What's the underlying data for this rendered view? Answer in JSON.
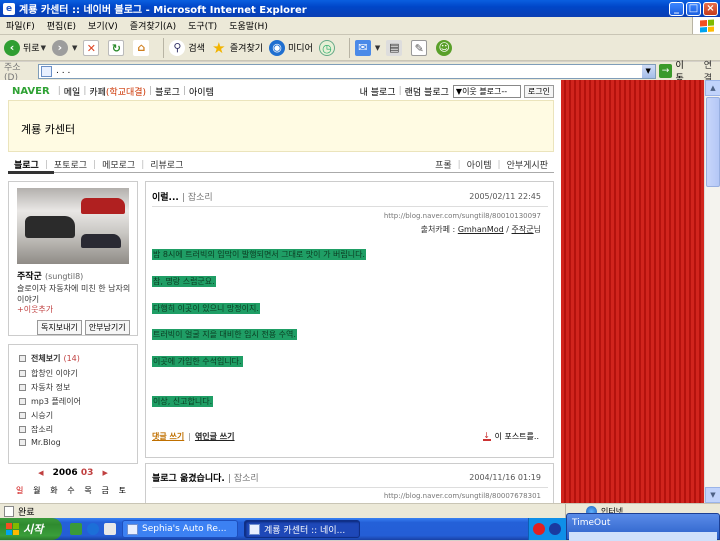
{
  "window": {
    "title": "계룡 카센터 :: 네이버 블로그 - Microsoft Internet Explorer"
  },
  "menu": [
    "파일(F)",
    "편집(E)",
    "보기(V)",
    "즐겨찾기(A)",
    "도구(T)",
    "도움말(H)"
  ],
  "toolbar": {
    "back": "뒤로",
    "search": "검색",
    "favorites": "즐겨찾기",
    "media": "미디어"
  },
  "address": {
    "label": "주소(D)",
    "url": ". . .",
    "go": "이동",
    "links": "연결"
  },
  "naver": {
    "logo": "NAVER",
    "nav": [
      "메일",
      "카페",
      "(학교대결)",
      "블로그",
      "아이템"
    ],
    "nav_right": [
      "내 블로그",
      "랜덤 블로그"
    ],
    "neighbor_select": "이웃 블로그--",
    "login": "로그인"
  },
  "blog": {
    "title": "계룡 카센터",
    "tabs": [
      "블로그",
      "포토로그",
      "메모로그",
      "리뷰로그"
    ],
    "tabs_right": [
      "프롤",
      "아이템",
      "안부게시판"
    ]
  },
  "profile": {
    "name": "주작군",
    "id": "(sungtil8)",
    "desc": "슬로이자 자동차에 미친 한 남자의 이야기",
    "add_neighbor": "+이웃추가",
    "btn_diary": "독지보내기",
    "btn_guestbook": "안부남기기"
  },
  "categories": {
    "all_label": "전체보기",
    "all_count": "(14)",
    "items": [
      "합창인 이야기",
      "자동차 정보",
      "mp3 플레이어",
      "시승기",
      "잡소리",
      "Mr.Blog"
    ]
  },
  "calendar": {
    "year": "2006",
    "month": "03",
    "days": [
      "일",
      "월",
      "화",
      "수",
      "목",
      "금",
      "토"
    ]
  },
  "post": {
    "title": "이럴...",
    "category": "| 잡소리",
    "date": "2005/02/11 22:45",
    "url": "http://blog.naver.com/sungtil8/80010130097",
    "source_label": "출처카페 :",
    "source_cafe": "GmhanMod",
    "source_sep": "/",
    "source_user": "주작군",
    "source_suffix": "님",
    "lines": [
      "밤 8시에 트러빅의 입막이 발행되면서 그대로 맛이 가 버립니다.",
      "참, 명랑 스럽군요.",
      "다행히 이곳이 있으니 망정이지.",
      "트러빅이 얼굴 지을 대비한 임시 전용 수역.",
      "이곳에 가입한 수석입니다.",
      "이상, 신고합니다."
    ],
    "comment": "댓글 쓰기",
    "trackback": "엮인글 쓰기",
    "scrap": "이 포스트를.."
  },
  "post2": {
    "title": "블로그 옮겼습니다.",
    "category": "| 잡소리",
    "date": "2004/11/16 01:19",
    "url": "http://blog.naver.com/sungtil8/80007678301"
  },
  "status": {
    "text": "완료",
    "zone": "인터넷"
  },
  "taskbar": {
    "start": "시작",
    "tasks": [
      "Sephia's Auto Re...",
      "계룡 카센터 :: 네이..."
    ]
  },
  "popup": {
    "title": "TimeOut"
  },
  "colors": {
    "highlight": "#1f9e65",
    "naver_green": "#2fa234",
    "red_panel": "#d0241d"
  }
}
